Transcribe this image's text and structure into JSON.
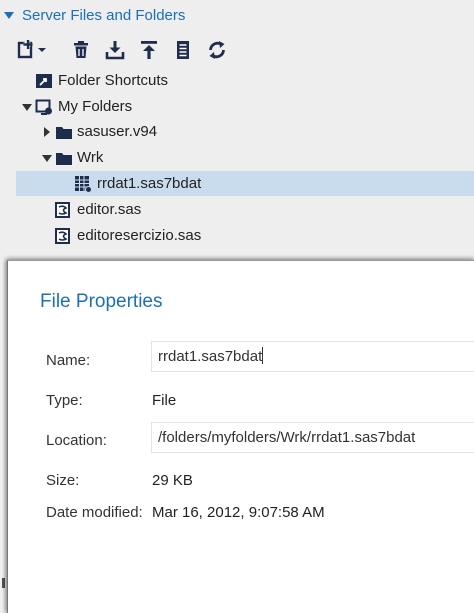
{
  "panel": {
    "title": "Server Files and Folders"
  },
  "toolbar": {
    "buttons": [
      {
        "name": "new-menu-button",
        "icon": "new-file-icon"
      },
      {
        "name": "delete-button",
        "icon": "trash-icon"
      },
      {
        "name": "download-button",
        "icon": "download-icon"
      },
      {
        "name": "upload-button",
        "icon": "upload-icon"
      },
      {
        "name": "properties-button",
        "icon": "properties-icon"
      },
      {
        "name": "refresh-button",
        "icon": "refresh-icon"
      }
    ]
  },
  "tree": {
    "items": [
      {
        "label": "Folder Shortcuts",
        "icon": "shortcut-icon"
      },
      {
        "label": "My Folders",
        "icon": "my-folders-icon",
        "expanded": true
      },
      {
        "label": "sasuser.v94",
        "icon": "folder-icon",
        "expanded": false
      },
      {
        "label": "Wrk",
        "icon": "folder-icon",
        "expanded": true
      },
      {
        "label": "rrdat1.sas7bdat",
        "icon": "dataset-icon",
        "selected": true
      },
      {
        "label": "editor.sas",
        "icon": "sas-program-icon"
      },
      {
        "label": "editoresercizio.sas",
        "icon": "sas-program-icon"
      }
    ]
  },
  "dialog": {
    "title": "File Properties",
    "name_label": "Name:",
    "name_value": "rrdat1.sas7bdat",
    "type_label": "Type:",
    "type_value": "File",
    "location_label": "Location:",
    "location_value": "/folders/myfolders/Wrk/rrdat1.sas7bdat",
    "size_label": "Size:",
    "size_value": "29 KB",
    "date_label": "Date modified:",
    "date_value": "Mar 16, 2012, 9:07:58 AM"
  },
  "colors": {
    "accent": "#1d6fb8",
    "selection": "#c9dcee",
    "icon_dark": "#1f2d4d"
  }
}
